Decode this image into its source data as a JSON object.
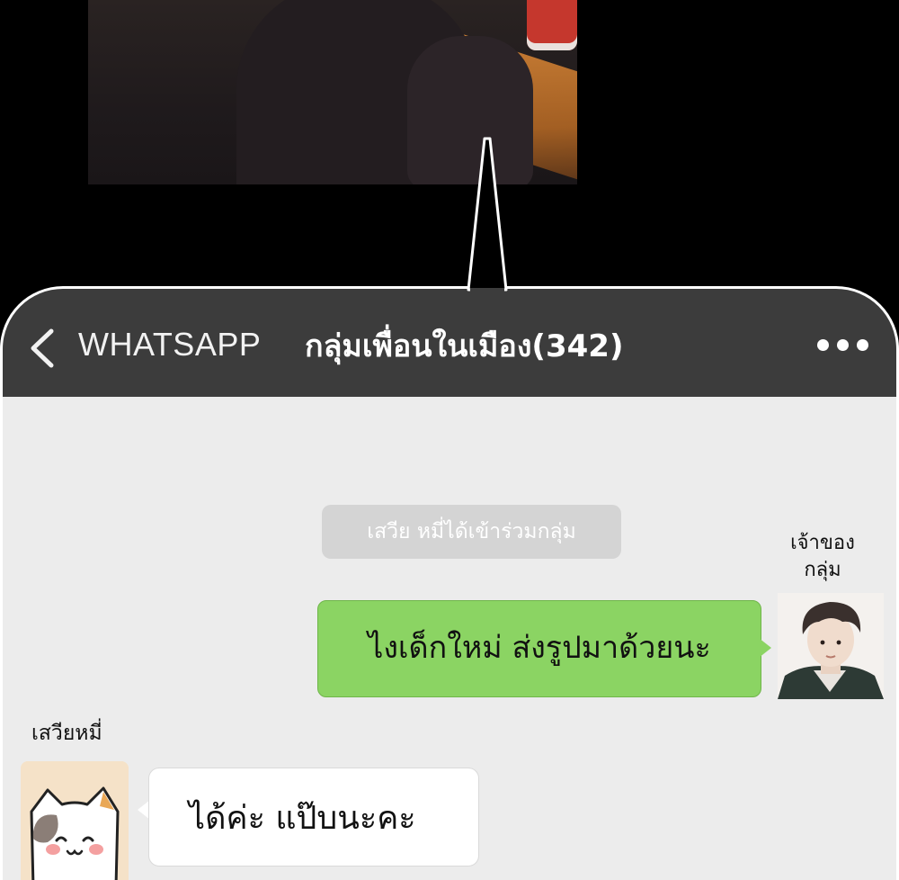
{
  "header": {
    "app_name": "WHATSAPP",
    "group_name": "กลุ่มเพื่อนในเมือง(342)"
  },
  "chat": {
    "system_message": "เสวีย หมี่ได้เข้าร่วมกลุ่ม",
    "owner": {
      "label_line1": "เจ้าของ",
      "label_line2": "กลุ่ม",
      "message": "ไงเด็กใหม่ ส่งรูปมาด้วยนะ"
    },
    "member": {
      "name": "เสวียหมี่",
      "message": "ได้ค่ะ แป๊บนะคะ"
    }
  },
  "colors": {
    "header_bg": "#3c3c3c",
    "chat_bg": "#ececec",
    "sent_bubble": "#8bd463",
    "received_bubble": "#ffffff"
  },
  "icons": [
    "back-icon",
    "more-icon"
  ]
}
